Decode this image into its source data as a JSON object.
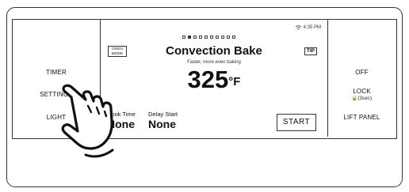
{
  "left_buttons": {
    "timer": "TIMER",
    "settings": "SETTINGS",
    "light": "LIGHT"
  },
  "right_buttons": {
    "off": "OFF",
    "lock": "LOCK",
    "lock_hint": "🔒(3sec)",
    "lift_panel": "LIFT PANEL"
  },
  "screen": {
    "status_time": "4:35 PM",
    "wifi_icon": "wifi-icon",
    "page_indicator": {
      "total": 10,
      "active_index": 1
    },
    "oven_mode_label": "OVEN MODE",
    "tip_label": "TIP",
    "mode_title": "Convection Bake",
    "mode_subtitle": "Faster, more even baking",
    "temperature": "325",
    "temperature_unit": "°F",
    "cook_time_label": "Cook Time",
    "cook_time_value": "None",
    "delay_start_label": "Delay Start",
    "delay_start_value": "None",
    "start_label": "START"
  },
  "colors": {
    "outline": "#333333",
    "background": "#ffffff",
    "text": "#111111"
  }
}
